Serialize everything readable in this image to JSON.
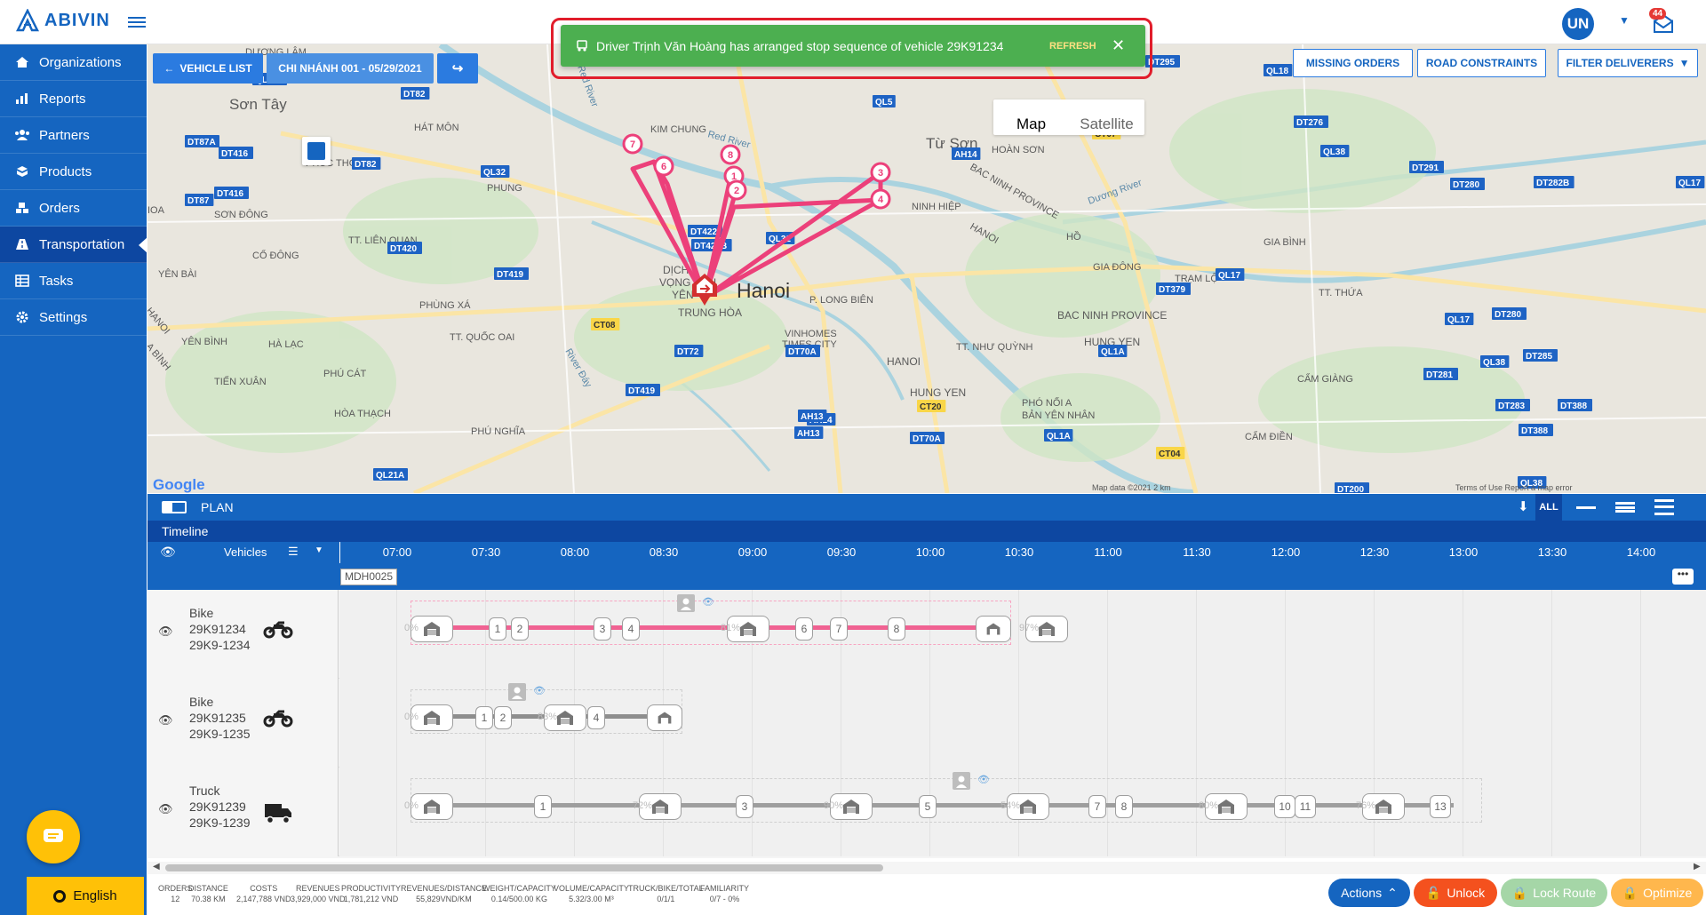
{
  "app": {
    "name": "ABIVIN",
    "user_initials": "UN",
    "notification_count": "44"
  },
  "sidebar": {
    "items": [
      {
        "label": "Organizations",
        "icon": "home-icon"
      },
      {
        "label": "Reports",
        "icon": "bar-chart-icon"
      },
      {
        "label": "Partners",
        "icon": "users-icon"
      },
      {
        "label": "Products",
        "icon": "boxes-icon"
      },
      {
        "label": "Orders",
        "icon": "cubes-icon"
      },
      {
        "label": "Transportation",
        "icon": "road-icon",
        "active": true
      },
      {
        "label": "Tasks",
        "icon": "table-icon"
      },
      {
        "label": "Settings",
        "icon": "gear-icon"
      }
    ],
    "language": "English"
  },
  "map": {
    "vehicle_list_label": "VEHICLE LIST",
    "branch_label": "CHI NHÁNH 001 - 05/29/2021",
    "missing_orders_label": "MISSING ORDERS",
    "road_constraints_label": "ROAD CONSTRAINTS",
    "filter_deliverers_label": "FILTER DELIVERERS",
    "map_type_map": "Map",
    "map_type_satellite": "Satellite",
    "google_label": "Google",
    "attribution": "Map data ©2021    2 km",
    "terms": "Terms of Use  Report a map error",
    "place_labels": [
      "Sơn Tây",
      "HÁT MÔN",
      "KIM CHUNG",
      "Từ Sơn",
      "HOÀN SƠN",
      "BAC NINH PROVINCE",
      "NINH HIỆP",
      "HANOI",
      "Hanoi",
      "DỊCH VỌNG HẬU",
      "YÊN",
      "TRUNG HÒA",
      "P. LONG BIÊN",
      "VINHOMES TIMES CITY",
      "TT. NHƯ QUỲNH",
      "BAC NINH PROVINCE",
      "HUNG YEN",
      "HÀ LẠC",
      "PHÚ CÁT",
      "HÒA THẠCH",
      "PHÚ NGHĨA",
      "TIẾN XUÂN",
      "YÊN BÌNH",
      "YÊN BÀI",
      "CỔ ĐÔNG",
      "TT. LIÊN QUAN",
      "PHÙNG XÁ",
      "TT. QUỐC OAI",
      "PHÚC THỌ",
      "PHUNG",
      "SƠN ĐÔNG",
      "GIA ĐÔNG",
      "TRẠM LỘ",
      "GIA BÌNH",
      "TT. THỨA",
      "CẨM GIÀNG",
      "PHÓ NỐI A",
      "BẢN YÊN NHÂN",
      "HUNG YEN",
      "HANOI",
      "HỒ",
      "Red River",
      "Red River",
      "Dương River",
      "River Đáy",
      "DƯƠNG LÂM",
      "TT. PHÚ MÔN",
      "CẨM ĐIỀN"
    ],
    "road_labels": [
      "QL21A",
      "DT82",
      "DT87A",
      "DT416",
      "DT82",
      "QL32",
      "DT416",
      "DT87",
      "QL5",
      "AH14",
      "CT07",
      "DT295",
      "QL18",
      "DT276",
      "QL38",
      "DT291",
      "DT280",
      "DT282B",
      "QL17",
      "DT422",
      "DT422B",
      "QL32",
      "DT420",
      "DT419",
      "CT08",
      "DT72",
      "DT70A",
      "DT419",
      "AH14",
      "QL1A",
      "DT379",
      "QL17",
      "QL17",
      "DT280",
      "DT285",
      "DT281",
      "QL38",
      "DT283",
      "CT20",
      "AH13",
      "AH13",
      "QL1A",
      "DT70A",
      "CT04",
      "DT388",
      "DT388",
      "QL38",
      "DT200",
      "QL21A"
    ],
    "route_stops": [
      "7",
      "6",
      "8",
      "1",
      "2",
      "3",
      "4"
    ]
  },
  "toast": {
    "message": "Driver Trịnh Văn Hoàng has arranged stop sequence of vehicle 29K91234",
    "refresh_label": "REFRESH",
    "color": "#4caf50"
  },
  "plan": {
    "title": "PLAN",
    "all_label": "ALL",
    "timeline_label": "Timeline",
    "vehicles_label": "Vehicles",
    "times": [
      "07:00",
      "07:30",
      "08:00",
      "08:30",
      "09:00",
      "09:30",
      "10:00",
      "10:30",
      "11:00",
      "11:30",
      "12:00",
      "12:30",
      "13:00",
      "13:30",
      "14:00"
    ],
    "group_label": "MDH0025"
  },
  "vehicles": [
    {
      "type": "Bike",
      "plate": "29K91234",
      "code": "29K9-1234",
      "route_color": "#f06292",
      "stops": [
        "1",
        "2",
        "3",
        "4",
        "6",
        "7",
        "8"
      ],
      "depot_pcts": [
        "0%",
        "81%",
        "97%"
      ]
    },
    {
      "type": "Bike",
      "plate": "29K91235",
      "code": "29K9-1235",
      "route_color": "#8e8e8e",
      "stops": [
        "1",
        "2",
        "4"
      ],
      "depot_pcts": [
        "0%",
        "83%",
        "78%"
      ]
    },
    {
      "type": "Truck",
      "plate": "29K91239",
      "code": "29K9-1239",
      "route_color": "#9e9e9e",
      "stops": [
        "1",
        "3",
        "5",
        "7",
        "8",
        "10",
        "11",
        "13"
      ],
      "depot_pcts": [
        "0%",
        "72%",
        "90%",
        "54%",
        "80%",
        "76%",
        "87%"
      ]
    }
  ],
  "stats": [
    {
      "label": "ORDERS",
      "value": "12"
    },
    {
      "label": "DISTANCE",
      "value": "70.38 KM"
    },
    {
      "label": "COSTS",
      "value": "2,147,788 VND"
    },
    {
      "label": "REVENUES",
      "value": "3,929,000 VND"
    },
    {
      "label": "PRODUCTIVITY",
      "value": "1,781,212 VND"
    },
    {
      "label": "REVENUES/DISTANCE",
      "value": "55,829VND/KM"
    },
    {
      "label": "WEIGHT/CAPACITY",
      "value": "0.14/500.00 KG"
    },
    {
      "label": "VOLUME/CAPACITY",
      "value": "5.32/3.00 M³"
    },
    {
      "label": "TRUCK/BIKE/TOTAL",
      "value": "0/1/1"
    },
    {
      "label": "FAMILIARITY",
      "value": "0/7 - 0%"
    }
  ],
  "actions": {
    "actions_label": "Actions",
    "unlock_label": "Unlock",
    "lock_route_label": "Lock Route",
    "optimize_label": "Optimize"
  }
}
